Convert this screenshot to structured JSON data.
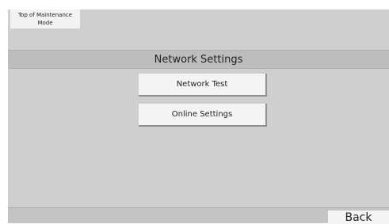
{
  "maintenance": {
    "top_button_label": "Top of Maintenance\nMode"
  },
  "header": {
    "title": "Network Settings"
  },
  "menu": {
    "items": [
      {
        "label": "Network Test"
      },
      {
        "label": "Online Settings"
      }
    ]
  },
  "footer": {
    "back_label": "Back"
  },
  "colors": {
    "screen_bg": "#cfcfcf",
    "header_bg": "#bdbdbd",
    "button_bg": "#f4f4f4"
  }
}
